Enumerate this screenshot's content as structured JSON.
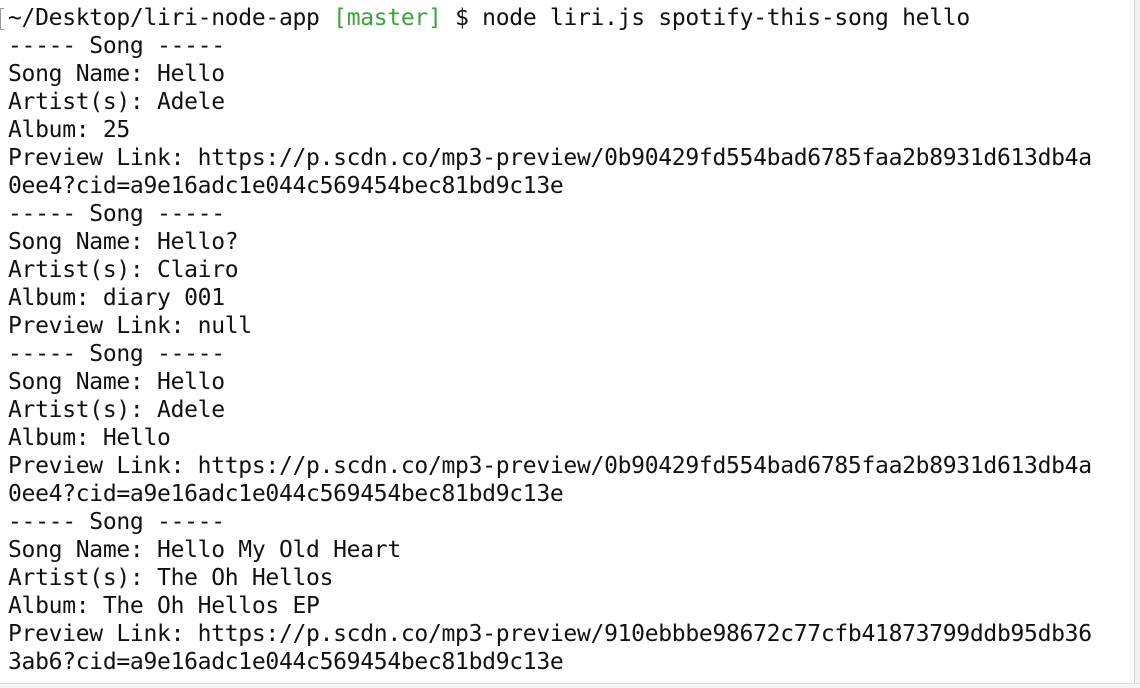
{
  "prompt": {
    "path": "~/Desktop/liri-node-app ",
    "branch": "[master]",
    "command": " $ node liri.js spotify-this-song hello"
  },
  "output": [
    "----- Song -----",
    "Song Name: Hello",
    "Artist(s): Adele",
    "Album: 25",
    "Preview Link: https://p.scdn.co/mp3-preview/0b90429fd554bad6785faa2b8931d613db4a",
    "0ee4?cid=a9e16adc1e044c569454bec81bd9c13e",
    "----- Song -----",
    "Song Name: Hello?",
    "Artist(s): Clairo",
    "Album: diary 001",
    "Preview Link: null",
    "----- Song -----",
    "Song Name: Hello",
    "Artist(s): Adele",
    "Album: Hello",
    "Preview Link: https://p.scdn.co/mp3-preview/0b90429fd554bad6785faa2b8931d613db4a",
    "0ee4?cid=a9e16adc1e044c569454bec81bd9c13e",
    "----- Song -----",
    "Song Name: Hello My Old Heart",
    "Artist(s): The Oh Hellos",
    "Album: The Oh Hellos EP",
    "Preview Link: https://p.scdn.co/mp3-preview/910ebbbe98672c77cfb41873799ddb95db36",
    "3ab6?cid=a9e16adc1e044c569454bec81bd9c13e"
  ],
  "colors": {
    "background": "#ffffff",
    "text": "#111111",
    "branch": "#3ba33b"
  }
}
